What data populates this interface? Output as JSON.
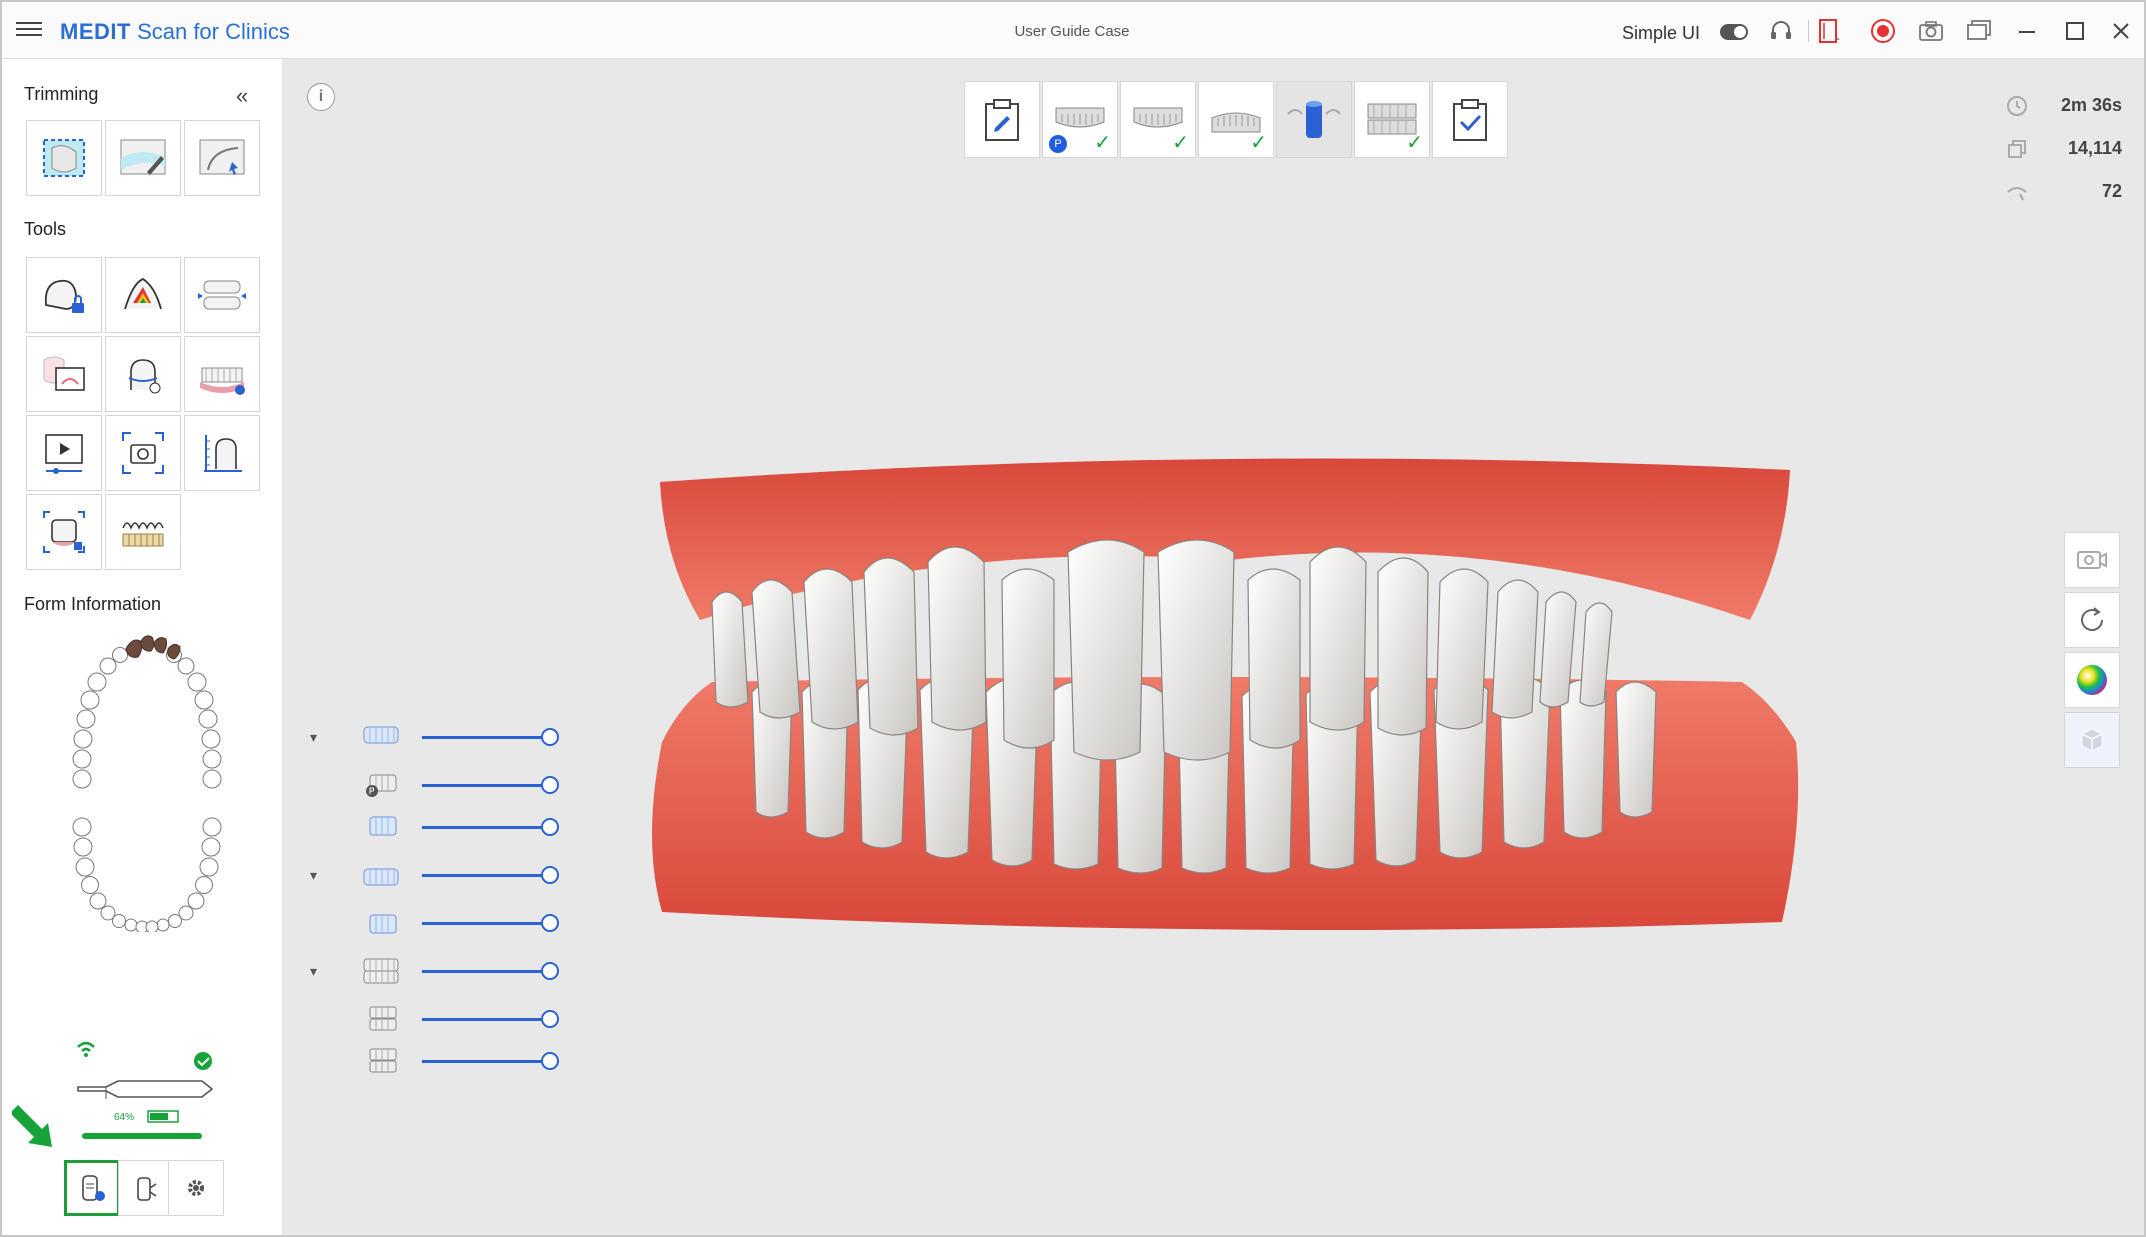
{
  "app": {
    "brand_bold": "MEDIT",
    "brand_rest": " Scan for Clinics",
    "case_title": "User Guide Case",
    "simple_ui_label": "Simple UI"
  },
  "left_panel": {
    "trimming_title": "Trimming",
    "tools_title": "Tools",
    "form_info_title": "Form Information",
    "collapse_glyph": "«",
    "trimming_tools": [
      "lasso-select-icon",
      "brush-trim-icon",
      "smart-trim-icon"
    ],
    "tools": [
      "lock-scan-icon",
      "color-heatmap-icon",
      "occlusion-align-icon",
      "data-compare-icon",
      "margin-line-icon",
      "full-arch-icon",
      "video-capture-icon",
      "screen-capture-icon",
      "measure-icon",
      "abutment-scan-icon",
      "smile-design-icon"
    ],
    "scanner_battery": "64%"
  },
  "viewport": {
    "info_glyph": "i",
    "stages": [
      {
        "name": "stage-notes",
        "done": false
      },
      {
        "name": "stage-maxilla",
        "done": true,
        "scanmark": "P"
      },
      {
        "name": "stage-mandible",
        "done": true
      },
      {
        "name": "stage-occlusion",
        "done": true
      },
      {
        "name": "stage-abutment",
        "done": false,
        "selected": true
      },
      {
        "name": "stage-full-occlusion",
        "done": true
      },
      {
        "name": "stage-complete",
        "done": false
      }
    ],
    "stats": {
      "time": "2m 36s",
      "shots": "14,114",
      "sweeps": "72"
    },
    "right_toolbar": [
      "camera-view-icon",
      "reset-rotation-icon",
      "color-map-icon",
      "texture-toggle-icon"
    ],
    "layers": [
      {
        "caret": "▾",
        "icon": "maxilla-group-icon"
      },
      {
        "caret": "",
        "icon": "maxilla-pre-op-icon"
      },
      {
        "caret": "",
        "icon": "maxilla-scan-icon"
      },
      {
        "caret": "▾",
        "icon": "mandible-group-icon"
      },
      {
        "caret": "",
        "icon": "mandible-scan-icon"
      },
      {
        "caret": "▾",
        "icon": "occlusion-group-icon"
      },
      {
        "caret": "",
        "icon": "occlusion-1-icon"
      },
      {
        "caret": "",
        "icon": "occlusion-2-icon"
      }
    ]
  },
  "colors": {
    "brand_blue": "#2b6fd6",
    "slider_blue": "#2a62d4",
    "check_green": "#18a33a",
    "gum": "#e0604e",
    "record_red": "#e53232"
  }
}
